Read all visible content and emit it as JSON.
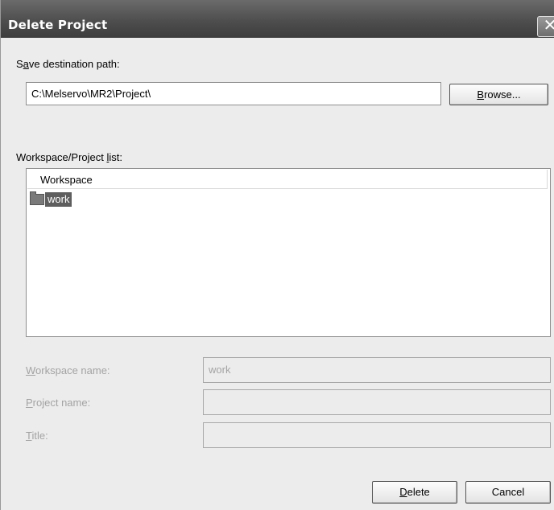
{
  "dialog": {
    "title": "Delete Project",
    "close_glyph": "✕"
  },
  "save_path": {
    "label_pre": "S",
    "label_key": "a",
    "label_post": "ve destination path:",
    "value": "C:\\Melservo\\MR2\\Project\\",
    "browse_key": "B",
    "browse_rest": "rowse..."
  },
  "workspace_list": {
    "label_pre": "Workspace/Project ",
    "label_key": "l",
    "label_post": "ist:",
    "header": "Workspace",
    "items": [
      {
        "label": "work",
        "icon": "folder-icon",
        "selected": true
      }
    ]
  },
  "fields": {
    "workspace_name": {
      "label_key": "W",
      "label_rest": "orkspace name:",
      "value": "work"
    },
    "project_name": {
      "label_key": "P",
      "label_rest": "roject name:",
      "value": ""
    },
    "title": {
      "label_key": "T",
      "label_rest": "itle:",
      "value": ""
    }
  },
  "buttons": {
    "delete_key": "D",
    "delete_rest": "elete",
    "cancel": "Cancel"
  }
}
